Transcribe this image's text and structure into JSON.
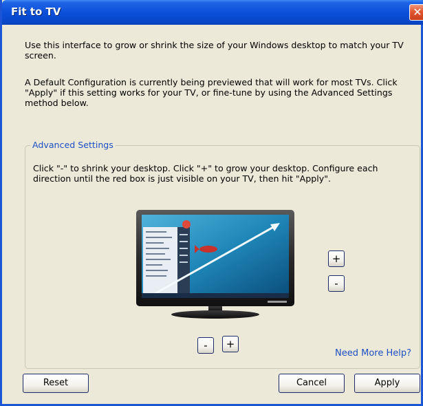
{
  "window": {
    "title": "Fit to TV",
    "close_symbol": "✕"
  },
  "intro": {
    "paragraph1": "Use this interface to grow or shrink the size of your Windows desktop to match your TV screen.",
    "paragraph2": "A Default Configuration is currently being previewed that will work for most TVs. Click \"Apply\" if this setting works for your TV, or fine-tune by using the Advanced Settings method below."
  },
  "advanced": {
    "title": "Advanced Settings",
    "instructions": "Click \"-\" to shrink your desktop. Click \"+\" to grow your desktop. Configure each direction until the red box is just visible on your TV, then hit \"Apply\".",
    "vertical_plus": "+",
    "vertical_minus": "-",
    "horizontal_minus": "-",
    "horizontal_plus": "+",
    "help_link": "Need More Help?"
  },
  "footer": {
    "reset": "Reset",
    "cancel": "Cancel",
    "apply": "Apply"
  },
  "icons": {
    "close": "close-icon",
    "tv": "tv-monitor-icon"
  },
  "colors": {
    "titlebar": "#0a4ed8",
    "window_bg": "#ece9d8",
    "link": "#1c4fc4",
    "close": "#d64b24"
  }
}
